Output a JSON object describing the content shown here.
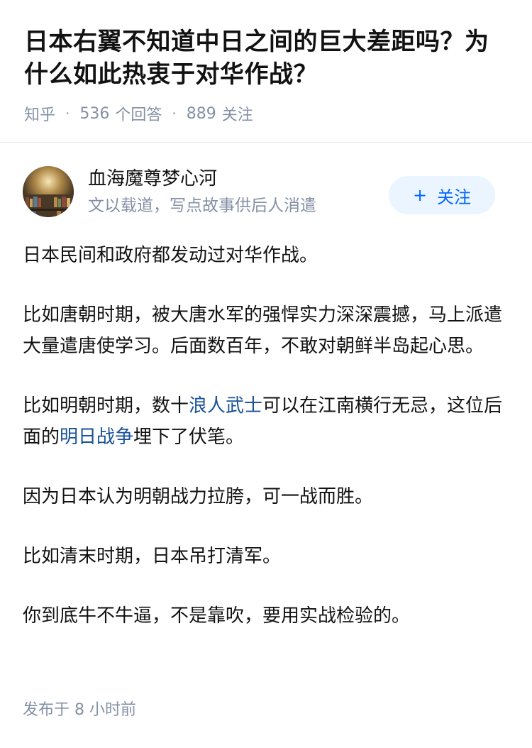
{
  "question": {
    "title": "日本右翼不知道中日之间的巨大差距吗？为什么如此热衷于对华作战？",
    "source": "知乎",
    "answer_count": "536",
    "answer_label": "个回答",
    "follower_count": "889",
    "follower_label": "关注"
  },
  "author": {
    "name": "血海魔尊梦心河",
    "bio": "文以载道，写点故事供后人消遣",
    "follow_icon": "+",
    "follow_label": "关注"
  },
  "answer": {
    "p1": "日本民间和政府都发动过对华作战。",
    "p2": "比如唐朝时期，被大唐水军的强悍实力深深震撼，马上派遣大量遣唐使学习。后面数百年，不敢对朝鲜半岛起心思。",
    "p3_before": "比如明朝时期，数十",
    "p3_link1": "浪人武士",
    "p3_middle": "可以在江南横行无忌，这位后面的",
    "p3_link2": "明日战争",
    "p3_after": "埋下了伏笔。",
    "p4": "因为日本认为明朝战力拉胯，可一战而胜。",
    "p5": "比如清末时期，日本吊打清军。",
    "p6": "你到底牛不牛逼，不是靠吹，要用实战检验的。"
  },
  "footer": {
    "posted_label": "发布于",
    "posted_time": "8 小时前"
  },
  "colors": {
    "link": "#175199",
    "muted": "#8590a6",
    "follow_bg": "#ebf5ff",
    "follow_text": "#0066ff"
  }
}
